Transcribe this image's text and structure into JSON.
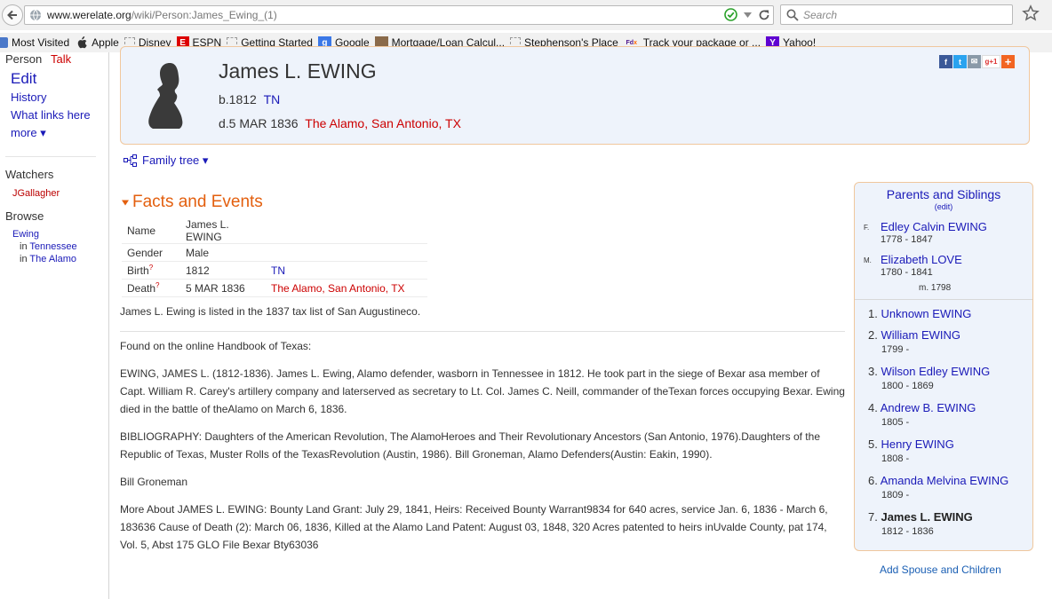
{
  "browser": {
    "url_domain": "www.werelate.org",
    "url_path": "/wiki/Person:James_Ewing_(1)",
    "search_placeholder": "Search"
  },
  "bookmarks": [
    {
      "label": "Most Visited",
      "icon": "bookmark-folder-icon"
    },
    {
      "label": "Apple",
      "icon": "apple-icon"
    },
    {
      "label": "Disney",
      "icon": "blank-page-icon"
    },
    {
      "label": "ESPN",
      "icon": "espn-icon"
    },
    {
      "label": "Getting Started",
      "icon": "blank-page-icon"
    },
    {
      "label": "Google",
      "icon": "google-icon"
    },
    {
      "label": "Mortgage/Loan Calcul...",
      "icon": "photo-icon"
    },
    {
      "label": "Stephenson's Place",
      "icon": "blank-page-icon"
    },
    {
      "label": "Track your package or ...",
      "icon": "fedex-icon"
    },
    {
      "label": "Yahoo!",
      "icon": "yahoo-icon"
    }
  ],
  "sidebar": {
    "person": "Person",
    "talk": "Talk",
    "edit": "Edit",
    "history": "History",
    "what_links": "What links here",
    "more": "more ▾",
    "watchers_heading": "Watchers",
    "watcher": "JGallagher",
    "browse_heading": "Browse",
    "browse_surname": "Ewing",
    "browse_in": "in",
    "browse_place1": "Tennessee",
    "browse_place2": "The Alamo"
  },
  "person": {
    "name": "James L. EWING",
    "birth_prefix": "b.1812",
    "birth_place": "TN",
    "death_prefix": "d.5 MAR 1836",
    "death_place": "The Alamo, San Antonio, TX"
  },
  "family_tree_label": "Family tree ▾",
  "facts": {
    "title": "Facts and Events",
    "rows": [
      {
        "label": "Name",
        "value": "James L. EWING",
        "place": ""
      },
      {
        "label": "Gender",
        "value": "Male",
        "place": ""
      },
      {
        "label": "Birth",
        "value": "1812",
        "place": "TN"
      },
      {
        "label": "Death",
        "value": "5 MAR 1836",
        "place": "The Alamo, San Antonio, TX"
      }
    ],
    "q": "?"
  },
  "text": {
    "p1": "James L. Ewing is listed in the 1837 tax list of San Augustineco.",
    "p2": "Found on the online Handbook of Texas:",
    "p3": "EWING, JAMES L. (1812-1836). James L. Ewing, Alamo defender, wasborn in Tennessee in 1812. He took part in the siege of Bexar asa member of Capt. William R. Carey's artillery company and laterserved as secretary to Lt. Col. James C. Neill, commander of theTexan forces occupying Bexar. Ewing died in the battle of theAlamo on March 6, 1836.",
    "p4": "BIBLIOGRAPHY: Daughters of the American Revolution, The AlamoHeroes and Their Revolutionary Ancestors (San Antonio, 1976).Daughters of the Republic of Texas, Muster Rolls of the TexasRevolution (Austin, 1986). Bill Groneman, Alamo Defenders(Austin: Eakin, 1990).",
    "p5": "Bill Groneman",
    "p6": "More About JAMES L. EWING: Bounty Land Grant: July 29, 1841, Heirs: Received Bounty Warrant9834 for 640 acres, service Jan. 6, 1836 - March 6, 183636 Cause of Death (2): March 06, 1836, Killed at the Alamo Land Patent: August 03, 1848, 320 Acres patented to heirs inUvalde County, pat 174, Vol. 5, Abst 175 GLO File Bexar Bty63036"
  },
  "family": {
    "title": "Parents and Siblings",
    "edit": "(edit)",
    "father_tag": "F.",
    "father_name": "Edley Calvin EWING",
    "father_dates": "1778 - 1847",
    "mother_tag": "M.",
    "mother_name": "Elizabeth LOVE",
    "mother_dates": "1780 - 1841",
    "marriage": "m. 1798",
    "siblings": [
      {
        "num": "1.",
        "name": "Unknown EWING",
        "dates": ""
      },
      {
        "num": "2.",
        "name": "William EWING",
        "dates": "1799 -"
      },
      {
        "num": "3.",
        "name": "Wilson Edley EWING",
        "dates": "1800 - 1869"
      },
      {
        "num": "4.",
        "name": "Andrew B. EWING",
        "dates": "1805 -"
      },
      {
        "num": "5.",
        "name": "Henry EWING",
        "dates": "1808 -"
      },
      {
        "num": "6.",
        "name": "Amanda Melvina EWING",
        "dates": "1809 -"
      },
      {
        "num": "7.",
        "name": "James L. EWING",
        "dates": "1812 - 1836"
      }
    ],
    "add_spouse": "Add Spouse and Children"
  },
  "share_icons": [
    "facebook-icon",
    "twitter-icon",
    "email-icon",
    "google-plus-icon",
    "addthis-plus-icon"
  ],
  "share_labels": [
    "f",
    "t",
    "✉",
    "g+1",
    "+"
  ],
  "colors": {
    "accent_orange": "#e35f0e",
    "link_blue": "#1a1ab8",
    "place_red": "#cc0000",
    "panel_bg": "#eef3fb"
  }
}
